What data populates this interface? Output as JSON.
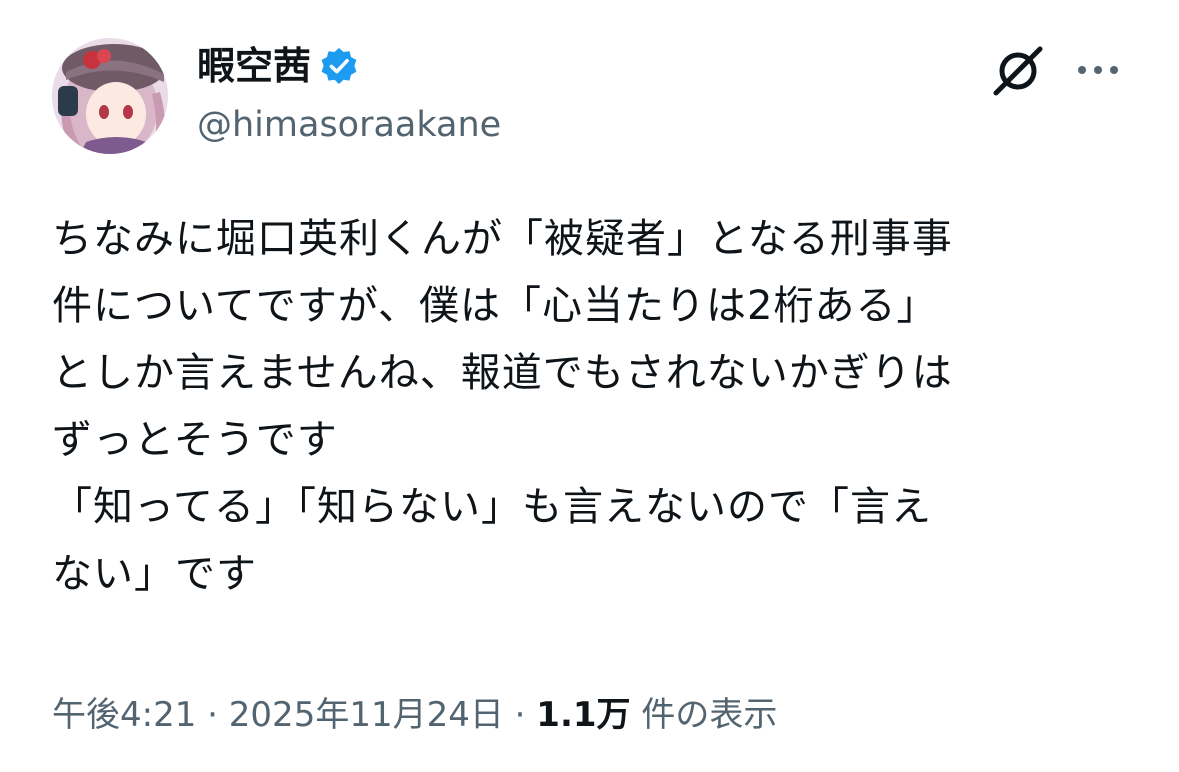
{
  "author": {
    "display_name": "暇空茜",
    "handle": "@himasoraakane",
    "verified": true
  },
  "icons": {
    "verified": "verified-badge-icon",
    "grok": "grok-icon",
    "more": "more-options-icon"
  },
  "tweet": {
    "lines": [
      "ちなみに堀口英利くんが「被疑者」となる刑事事",
      "件についてですが、僕は「心当たりは2桁ある」",
      "としか言えませんね、報道でもされないかぎりは",
      "ずっとそうです",
      "「知ってる」「知らない」も言えないので「言え",
      "ない」です"
    ]
  },
  "meta": {
    "time": "午後4:21",
    "separator": "·",
    "date": "2025年11月24日",
    "views_count": "1.1万",
    "views_label": "件の表示"
  },
  "colors": {
    "text": "#0f1419",
    "secondary": "#536471",
    "verified": "#1d9bf0"
  }
}
